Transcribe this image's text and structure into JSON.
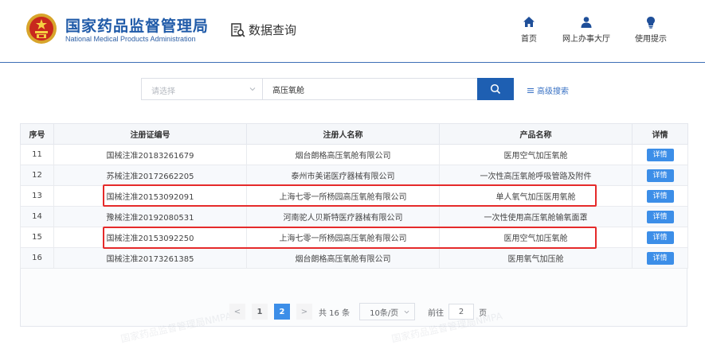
{
  "header": {
    "brand_cn": "国家药品监督管理局",
    "brand_en": "National Medical Products Administration",
    "section_title": "数据查询",
    "nav": [
      {
        "label": "首页",
        "icon": "home-icon"
      },
      {
        "label": "网上办事大厅",
        "icon": "user-icon"
      },
      {
        "label": "使用提示",
        "icon": "lightbulb-icon"
      }
    ],
    "colors": {
      "brand": "#1f5aa8",
      "accent": "#1e5fb2",
      "highlight": "#e52a2a"
    }
  },
  "search": {
    "select_placeholder": "请选择",
    "query_value": "高压氧舱",
    "advanced_label": "高级搜索"
  },
  "table": {
    "columns": [
      "序号",
      "注册证编号",
      "注册人名称",
      "产品名称",
      "详情"
    ],
    "rows": [
      {
        "no": "11",
        "reg": "国械注准20183261679",
        "holder": "烟台朗格高压氧舱有限公司",
        "product": "医用空气加压氧舱",
        "detail": "详情"
      },
      {
        "no": "12",
        "reg": "苏械注准20172662205",
        "holder": "泰州市美诺医疗器械有限公司",
        "product": "一次性高压氧舱呼吸管路及附件",
        "detail": "详情"
      },
      {
        "no": "13",
        "reg": "国械注准20153092091",
        "holder": "上海七零一所杨园高压氧舱有限公司",
        "product": "单人氧气加压医用氧舱",
        "detail": "详情"
      },
      {
        "no": "14",
        "reg": "豫械注准20192080531",
        "holder": "河南驼人贝斯特医疗器械有限公司",
        "product": "一次性使用高压氧舱输氧面罩",
        "detail": "详情"
      },
      {
        "no": "15",
        "reg": "国械注准20153092250",
        "holder": "上海七零一所杨园高压氧舱有限公司",
        "product": "医用空气加压氧舱",
        "detail": "详情"
      },
      {
        "no": "16",
        "reg": "国械注准20173261385",
        "holder": "烟台朗格高压氧舱有限公司",
        "product": "医用氧气加压舱",
        "detail": "详情"
      }
    ]
  },
  "pagination": {
    "prev": "<",
    "pages": [
      "1",
      "2"
    ],
    "current": "2",
    "next": ">",
    "total": "共 16 条",
    "page_size": "10条/页",
    "goto_label": "前往",
    "goto_value": "2",
    "goto_suffix": "页"
  },
  "watermark": "国家药品监督管理局NMPA"
}
